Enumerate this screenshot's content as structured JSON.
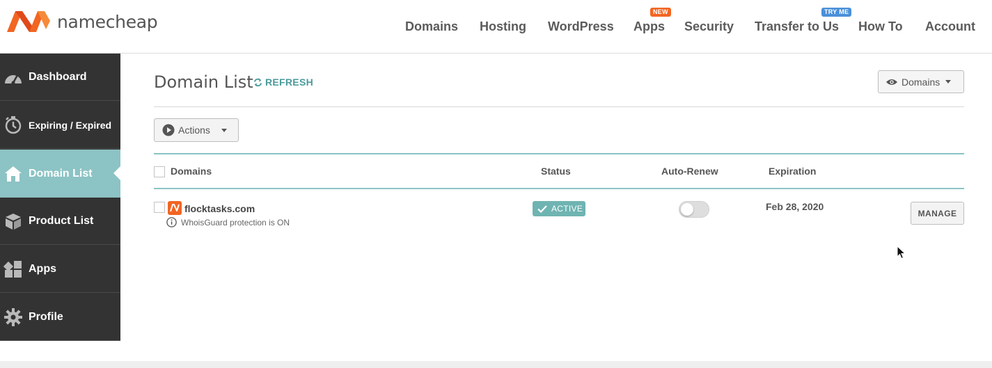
{
  "brand": {
    "name": "namecheap",
    "accent": "#f26522"
  },
  "nav": {
    "items": [
      {
        "label": "Domains"
      },
      {
        "label": "Hosting"
      },
      {
        "label": "WordPress"
      },
      {
        "label": "Apps",
        "badge": "NEW",
        "badge_color": "#f26522"
      },
      {
        "label": "Security"
      },
      {
        "label": "Transfer to Us",
        "badge": "TRY ME",
        "badge_color": "#4a90d9"
      },
      {
        "label": "How To"
      },
      {
        "label": "Account"
      }
    ]
  },
  "sidebar": {
    "items": [
      {
        "label": "Dashboard",
        "icon": "speedometer-icon"
      },
      {
        "label": "Expiring / Expired",
        "icon": "stopwatch-icon"
      },
      {
        "label": "Domain List",
        "icon": "home-icon",
        "active": true
      },
      {
        "label": "Product List",
        "icon": "box-icon"
      },
      {
        "label": "Apps",
        "icon": "apps-grid-icon"
      },
      {
        "label": "Profile",
        "icon": "gear-icon"
      }
    ],
    "active_color": "#8cc3c4"
  },
  "main": {
    "title": "Domain List",
    "refresh_label": "REFRESH",
    "view_dropdown": "Domains",
    "actions_label": "Actions",
    "columns": [
      "Domains",
      "Status",
      "Auto-Renew",
      "Expiration"
    ],
    "rows": [
      {
        "domain": "flocktasks.com",
        "note": "WhoisGuard protection is ON",
        "status": "ACTIVE",
        "auto_renew": false,
        "expiration": "Feb 28, 2020",
        "action": "MANAGE"
      }
    ]
  }
}
